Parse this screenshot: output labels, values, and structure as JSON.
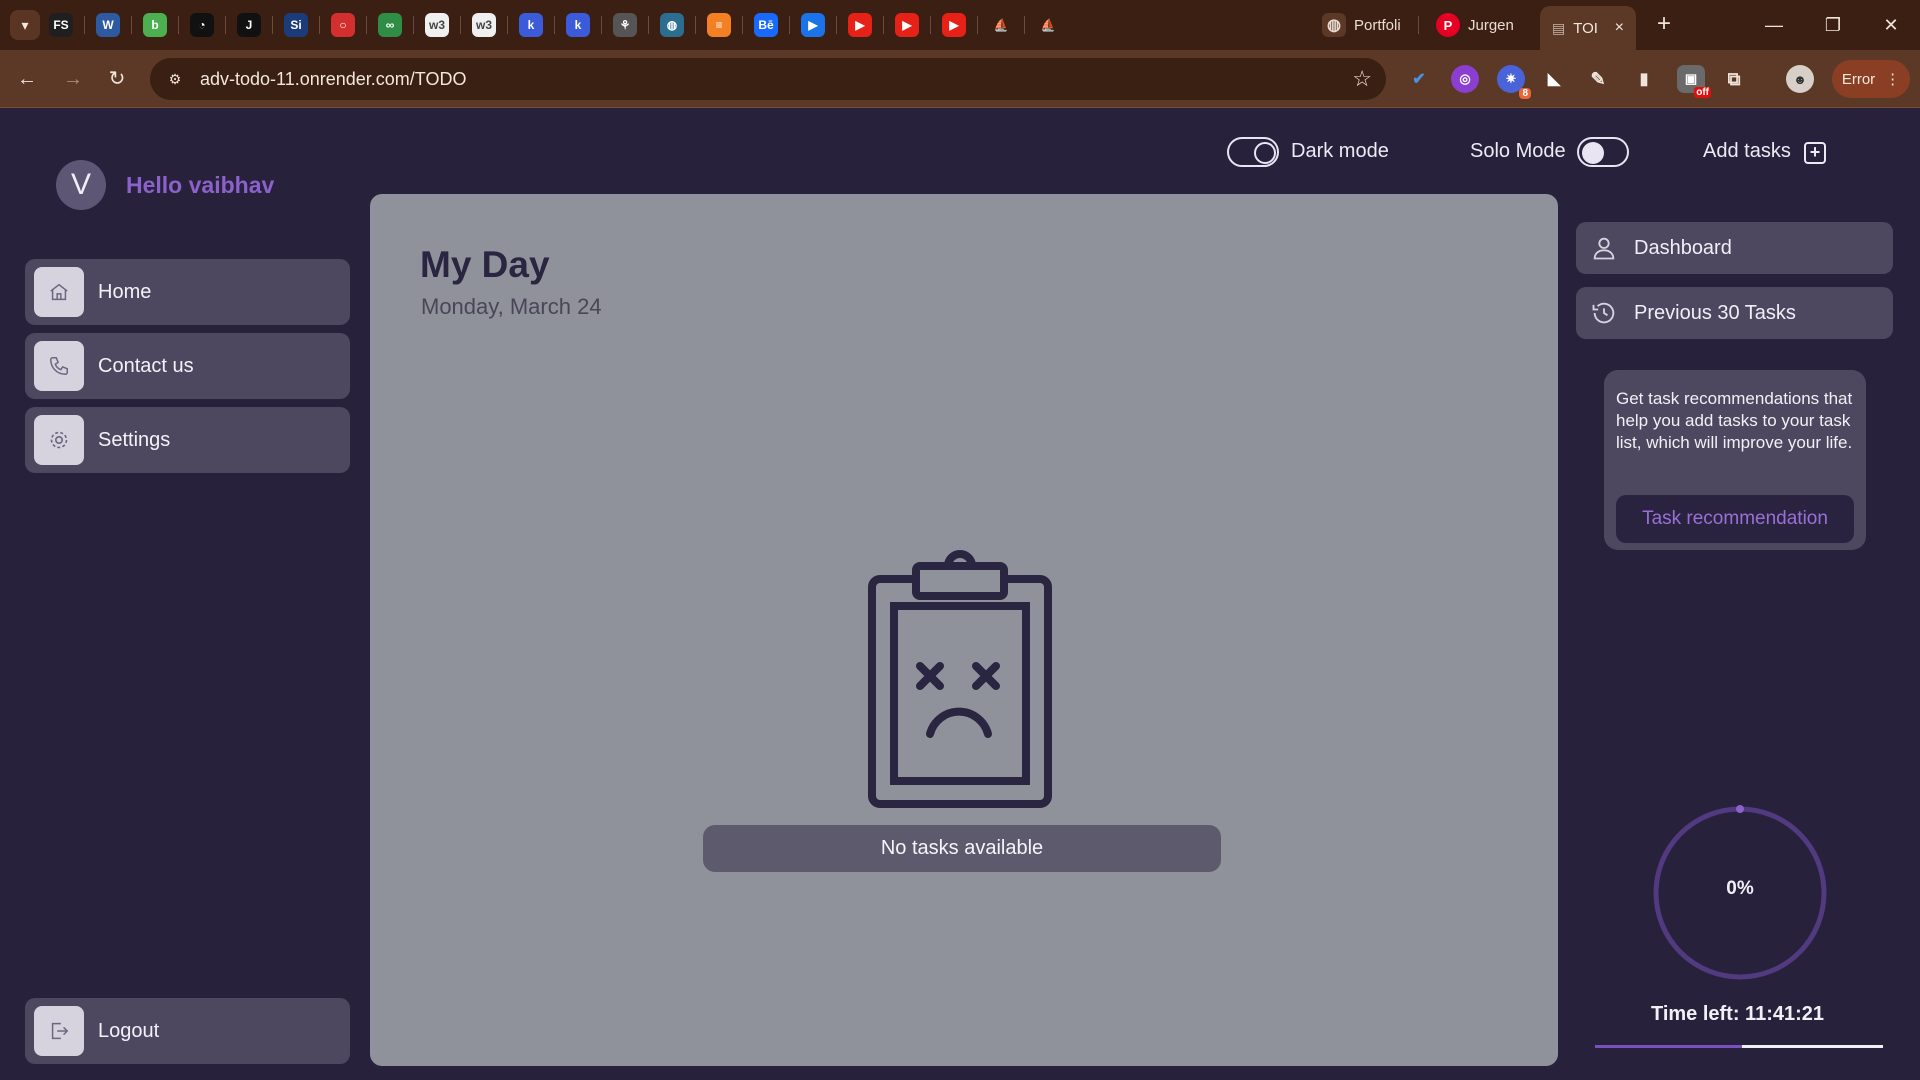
{
  "browser": {
    "tabs": [
      {
        "icon": "fs-favicon",
        "text": "FS",
        "color": "#1f1f1f"
      },
      {
        "icon": "sheet-favicon",
        "text": "W",
        "color": "#2d5aa0"
      },
      {
        "icon": "grammar-favicon",
        "text": "b",
        "color": "#4caf50"
      },
      {
        "icon": "clock-favicon",
        "text": "◔",
        "color": "#111111"
      },
      {
        "icon": "j-favicon",
        "text": "J",
        "color": "#111111"
      },
      {
        "icon": "si-favicon",
        "text": "Si",
        "color": "#1b3b7a"
      },
      {
        "icon": "oracle-favicon",
        "text": "○",
        "color": "#d32f2f"
      },
      {
        "icon": "gfg-favicon",
        "text": "∞",
        "color": "#2f8d46"
      },
      {
        "icon": "w3-favicon",
        "text": "w3",
        "color": "#f0f0f0"
      },
      {
        "icon": "w3-favicon",
        "text": "w3",
        "color": "#f0f0f0"
      },
      {
        "icon": "k-favicon",
        "text": "k",
        "color": "#3b5bdb"
      },
      {
        "icon": "k-favicon",
        "text": "k",
        "color": "#3b5bdb"
      },
      {
        "icon": "tree-favicon",
        "text": "⚘",
        "color": "#555555"
      },
      {
        "icon": "globe-favicon",
        "text": "◍",
        "color": "#2c6e8f"
      },
      {
        "icon": "stack-favicon",
        "text": "≡",
        "color": "#f48024"
      },
      {
        "icon": "behance-favicon",
        "text": "Bē",
        "color": "#1769ff"
      },
      {
        "icon": "play-favicon",
        "text": "▶",
        "color": "#1a73e8"
      },
      {
        "icon": "youtube-favicon",
        "text": "▶",
        "color": "#e62117"
      },
      {
        "icon": "youtube-favicon",
        "text": "▶",
        "color": "#e62117"
      },
      {
        "icon": "youtube-favicon",
        "text": "▶",
        "color": "#e62117"
      },
      {
        "icon": "ship-favicon",
        "text": "⛵",
        "color": "#3b1f12"
      },
      {
        "icon": "ship-favicon",
        "text": "⛵",
        "color": "#3b1f12"
      }
    ],
    "named_tabs": [
      {
        "label": "Portfoli",
        "icon": "globe-icon"
      },
      {
        "label": "Jurgen",
        "icon": "pinterest-icon"
      }
    ],
    "active_tab": {
      "label": "TOI",
      "close": "×"
    },
    "new_tab": "+",
    "window": {
      "minimize": "—",
      "maximize": "❐",
      "close": "✕"
    },
    "url": "adv-todo-11.onrender.com/TODO",
    "error_label": "Error",
    "extensions_badge": "8",
    "off_badge": "off"
  },
  "header": {
    "dark_mode_label": "Dark mode",
    "solo_mode_label": "Solo Mode",
    "add_tasks_label": "Add tasks",
    "dark_mode_on": true,
    "solo_mode_on": false
  },
  "user": {
    "avatar_initial": "V",
    "greeting": "Hello vaibhav"
  },
  "sidebar": {
    "items": [
      {
        "label": "Home",
        "icon": "home-icon"
      },
      {
        "label": "Contact us",
        "icon": "phone-icon"
      },
      {
        "label": "Settings",
        "icon": "gear-icon"
      }
    ],
    "logout_label": "Logout"
  },
  "main": {
    "title": "My Day",
    "date": "Monday, March 24",
    "empty_message": "No tasks available"
  },
  "right_panel": {
    "dashboard_label": "Dashboard",
    "previous_label": "Previous 30 Tasks",
    "recommendation_text": "Get task recommendations that help you add tasks to your task list, which will improve your life.",
    "recommendation_button": "Task recommendation",
    "progress_percent": 0,
    "progress_label": "0%",
    "time_left": "Time left: 11:41:21",
    "time_elapsed_fraction": 0.51
  },
  "colors": {
    "app_bg": "#27213c",
    "accent": "#8b62c9",
    "card": "#8f929b",
    "panel": "#4e4760"
  }
}
